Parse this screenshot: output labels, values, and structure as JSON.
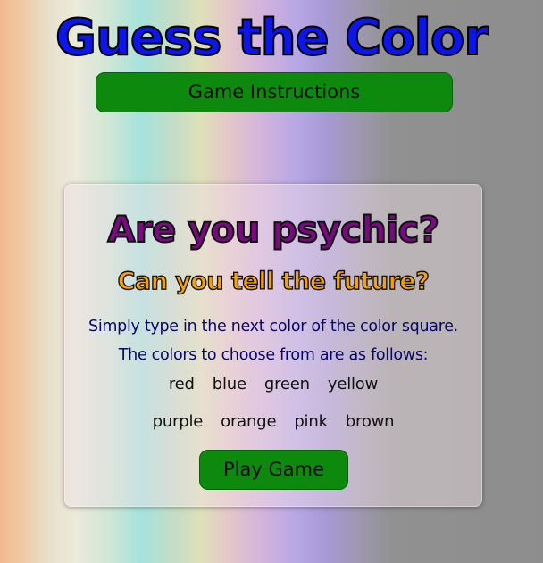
{
  "header": {
    "title": "Guess the Color",
    "instructions_button": "Game Instructions"
  },
  "card": {
    "heading": "Are you psychic?",
    "subheading": "Can you tell the future?",
    "line1": "Simply type in the next color of the color square.",
    "line2": "The colors to choose from are as follows:",
    "colors_row1": [
      "red",
      "blue",
      "green",
      "yellow"
    ],
    "colors_row2": [
      "purple",
      "orange",
      "pink",
      "brown"
    ],
    "play_button": "Play Game"
  },
  "theme": {
    "title_color": "#0d16e8",
    "button_color": "#0d8a0d",
    "heading_color": "#7a0a80",
    "subheading_color": "#f5a10a",
    "text_color": "#07076a"
  }
}
